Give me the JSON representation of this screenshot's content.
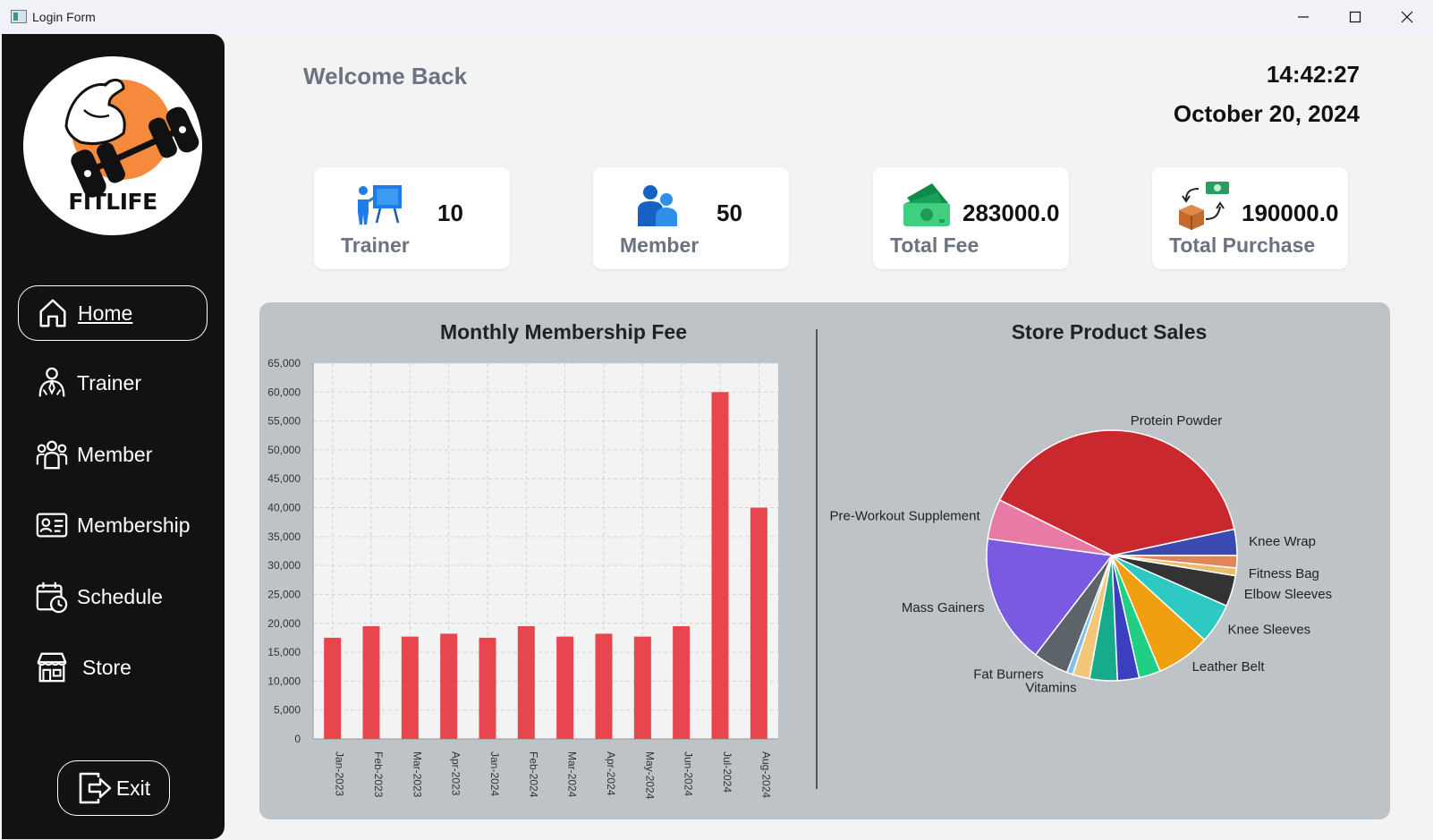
{
  "window": {
    "title": "Login Form",
    "minimize_icon": "minimize-icon",
    "maximize_icon": "maximize-icon",
    "close_icon": "close-icon"
  },
  "sidebar": {
    "logo_text": "FITLIFE",
    "items": [
      {
        "label": "Home",
        "icon": "home-icon",
        "active": true
      },
      {
        "label": "Trainer",
        "icon": "trainer-icon"
      },
      {
        "label": "Member",
        "icon": "members-icon"
      },
      {
        "label": "Membership",
        "icon": "id-card-icon"
      },
      {
        "label": "Schedule",
        "icon": "calendar-clock-icon"
      },
      {
        "label": "Store",
        "icon": "store-icon"
      }
    ],
    "exit_label": "Exit"
  },
  "header": {
    "welcome": "Welcome Back",
    "time": "14:42:27",
    "date": "October 20, 2024"
  },
  "cards": [
    {
      "label": "Trainer",
      "value": "10",
      "icon": "presentation-board-icon"
    },
    {
      "label": "Member",
      "value": "50",
      "icon": "people-icon"
    },
    {
      "label": "Total Fee",
      "value": "283000.0",
      "icon": "cash-icon"
    },
    {
      "label": "Total Purchase",
      "value": "190000.0",
      "icon": "purchase-exchange-icon"
    }
  ],
  "colors": {
    "sidebar_bg": "#121212",
    "bar": "#e8464e",
    "logo_orange": "#f58a3c",
    "panel_bg": "#bec3c8",
    "label_gray": "#6b7380"
  },
  "chart_data": [
    {
      "type": "bar",
      "title": "Monthly Membership Fee",
      "categories": [
        "Jan-2023",
        "Feb-2023",
        "Mar-2023",
        "Apr-2023",
        "Jan-2024",
        "Feb-2024",
        "Mar-2024",
        "Apr-2024",
        "May-2024",
        "Jun-2024",
        "Jul-2024",
        "Aug-2024"
      ],
      "values": [
        17500,
        19500,
        17700,
        18200,
        17500,
        19500,
        17700,
        18200,
        17700,
        19500,
        60000,
        40000
      ],
      "ylim": [
        0,
        65000
      ],
      "yticks": [
        "0",
        "5,000",
        "10,000",
        "15,000",
        "20,000",
        "25,000",
        "30,000",
        "35,000",
        "40,000",
        "45,000",
        "50,000",
        "55,000",
        "60,000",
        "65,000"
      ],
      "grid": true
    },
    {
      "type": "pie",
      "title": "Store Product Sales",
      "slices": [
        {
          "label": "Knee Wrap",
          "value": 3.4,
          "color": "#3a4ab0"
        },
        {
          "label": "Protein Powder",
          "value": 39.5,
          "color": "#c8282e"
        },
        {
          "label": "Pre-Workout Supplement",
          "value": 5.2,
          "color": "#e87aa6"
        },
        {
          "label": "Mass Gainers",
          "value": 16.8,
          "color": "#7a5ae0"
        },
        {
          "label": "Fat Burners",
          "value": 4.6,
          "color": "#5d6469"
        },
        {
          "label": "",
          "value": 0.8,
          "color": "#7fc0ee"
        },
        {
          "label": "Vitamins",
          "value": 2.2,
          "color": "#f2c77a"
        },
        {
          "label": "",
          "value": 3.6,
          "color": "#16ab8a"
        },
        {
          "label": "",
          "value": 2.8,
          "color": "#3b3fbf"
        },
        {
          "label": "",
          "value": 2.8,
          "color": "#1fcf86"
        },
        {
          "label": "Leather Belt",
          "value": 7.0,
          "color": "#f0a00e"
        },
        {
          "label": "Knee Sleeves",
          "value": 5.2,
          "color": "#2ec9c3"
        },
        {
          "label": "Elbow Sleeves",
          "value": 4.0,
          "color": "#333333"
        },
        {
          "label": "Fitness Bag",
          "value": 1.0,
          "color": "#e9be6a"
        },
        {
          "label": "",
          "value": 1.6,
          "color": "#e0845c"
        }
      ]
    }
  ]
}
